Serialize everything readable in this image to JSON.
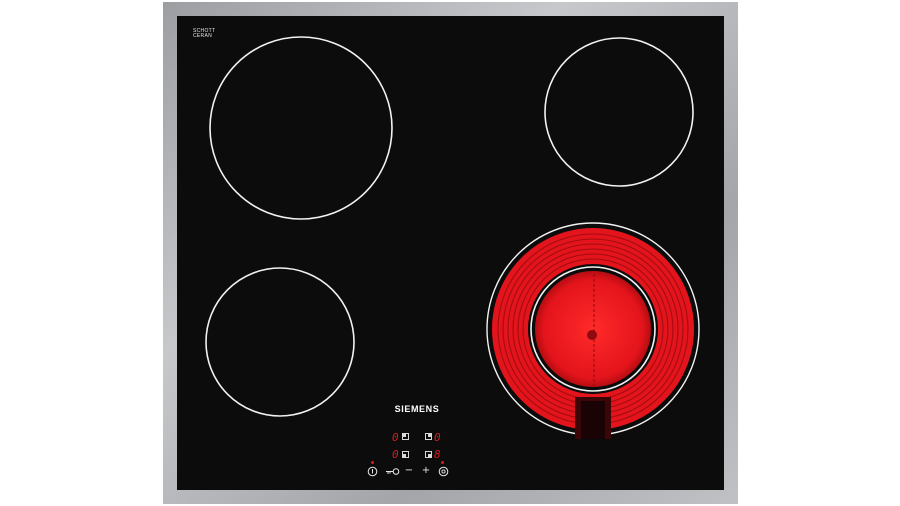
{
  "brand": "SIEMENS",
  "glass_logo": {
    "line1": "SCHOTT",
    "line2": "CERAN",
    "line3": ""
  },
  "displays": {
    "front_left": "0",
    "back_left": "0",
    "back_right": "0",
    "front_right": "8"
  },
  "controls": {
    "power_icon": "power-icon",
    "key_icon": "key-lock-icon",
    "minus_label": "−",
    "plus_label": "+",
    "timer_icon": "timer-icon"
  },
  "colors": {
    "frame": "#a8aaad",
    "glass": "#0c0c0c",
    "burner_ring": "#ffffff",
    "heating": "#e3141b",
    "display": "#d11f1f"
  },
  "active_zone": "front-right"
}
